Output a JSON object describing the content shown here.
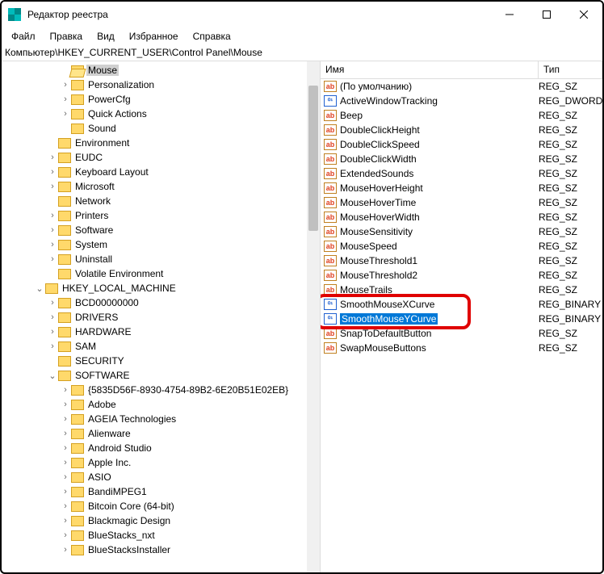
{
  "window": {
    "title": "Редактор реестра"
  },
  "menu": {
    "file": "Файл",
    "edit": "Правка",
    "view": "Вид",
    "favorites": "Избранное",
    "help": "Справка"
  },
  "path": "Компьютер\\HKEY_CURRENT_USER\\Control Panel\\Mouse",
  "columns": {
    "name": "Имя",
    "type": "Тип"
  },
  "tree": [
    {
      "ind": 72,
      "exp": "",
      "label": "Mouse",
      "selected": true,
      "open": true
    },
    {
      "ind": 72,
      "exp": ">",
      "label": "Personalization"
    },
    {
      "ind": 72,
      "exp": ">",
      "label": "PowerCfg"
    },
    {
      "ind": 72,
      "exp": ">",
      "label": "Quick Actions"
    },
    {
      "ind": 72,
      "exp": "",
      "label": "Sound"
    },
    {
      "ind": 56,
      "exp": "",
      "label": "Environment"
    },
    {
      "ind": 56,
      "exp": ">",
      "label": "EUDC"
    },
    {
      "ind": 56,
      "exp": ">",
      "label": "Keyboard Layout"
    },
    {
      "ind": 56,
      "exp": ">",
      "label": "Microsoft"
    },
    {
      "ind": 56,
      "exp": "",
      "label": "Network"
    },
    {
      "ind": 56,
      "exp": ">",
      "label": "Printers"
    },
    {
      "ind": 56,
      "exp": ">",
      "label": "Software"
    },
    {
      "ind": 56,
      "exp": ">",
      "label": "System"
    },
    {
      "ind": 56,
      "exp": ">",
      "label": "Uninstall"
    },
    {
      "ind": 56,
      "exp": "",
      "label": "Volatile Environment"
    },
    {
      "ind": 40,
      "exp": "v",
      "label": "HKEY_LOCAL_MACHINE",
      "nofolder": false
    },
    {
      "ind": 56,
      "exp": ">",
      "label": "BCD00000000"
    },
    {
      "ind": 56,
      "exp": ">",
      "label": "DRIVERS"
    },
    {
      "ind": 56,
      "exp": ">",
      "label": "HARDWARE"
    },
    {
      "ind": 56,
      "exp": ">",
      "label": "SAM"
    },
    {
      "ind": 56,
      "exp": "",
      "label": "SECURITY"
    },
    {
      "ind": 56,
      "exp": "v",
      "label": "SOFTWARE"
    },
    {
      "ind": 72,
      "exp": ">",
      "label": "{5835D56F-8930-4754-89B2-6E20B51E02EB}"
    },
    {
      "ind": 72,
      "exp": ">",
      "label": "Adobe"
    },
    {
      "ind": 72,
      "exp": ">",
      "label": "AGEIA Technologies"
    },
    {
      "ind": 72,
      "exp": ">",
      "label": "Alienware"
    },
    {
      "ind": 72,
      "exp": ">",
      "label": "Android Studio"
    },
    {
      "ind": 72,
      "exp": ">",
      "label": "Apple Inc."
    },
    {
      "ind": 72,
      "exp": ">",
      "label": "ASIO"
    },
    {
      "ind": 72,
      "exp": ">",
      "label": "BandiMPEG1"
    },
    {
      "ind": 72,
      "exp": ">",
      "label": "Bitcoin Core (64-bit)"
    },
    {
      "ind": 72,
      "exp": ">",
      "label": "Blackmagic Design"
    },
    {
      "ind": 72,
      "exp": ">",
      "label": "BlueStacks_nxt"
    },
    {
      "ind": 72,
      "exp": ">",
      "label": "BlueStacksInstaller"
    }
  ],
  "values": [
    {
      "name": "(По умолчанию)",
      "type": "REG_SZ",
      "kind": "sz"
    },
    {
      "name": "ActiveWindowTracking",
      "type": "REG_DWORD",
      "kind": "bin"
    },
    {
      "name": "Beep",
      "type": "REG_SZ",
      "kind": "sz"
    },
    {
      "name": "DoubleClickHeight",
      "type": "REG_SZ",
      "kind": "sz"
    },
    {
      "name": "DoubleClickSpeed",
      "type": "REG_SZ",
      "kind": "sz"
    },
    {
      "name": "DoubleClickWidth",
      "type": "REG_SZ",
      "kind": "sz"
    },
    {
      "name": "ExtendedSounds",
      "type": "REG_SZ",
      "kind": "sz"
    },
    {
      "name": "MouseHoverHeight",
      "type": "REG_SZ",
      "kind": "sz"
    },
    {
      "name": "MouseHoverTime",
      "type": "REG_SZ",
      "kind": "sz"
    },
    {
      "name": "MouseHoverWidth",
      "type": "REG_SZ",
      "kind": "sz"
    },
    {
      "name": "MouseSensitivity",
      "type": "REG_SZ",
      "kind": "sz"
    },
    {
      "name": "MouseSpeed",
      "type": "REG_SZ",
      "kind": "sz"
    },
    {
      "name": "MouseThreshold1",
      "type": "REG_SZ",
      "kind": "sz"
    },
    {
      "name": "MouseThreshold2",
      "type": "REG_SZ",
      "kind": "sz"
    },
    {
      "name": "MouseTrails",
      "type": "REG_SZ",
      "kind": "sz"
    },
    {
      "name": "SmoothMouseXCurve",
      "type": "REG_BINARY",
      "kind": "bin"
    },
    {
      "name": "SmoothMouseYCurve",
      "type": "REG_BINARY",
      "kind": "bin",
      "selected": true
    },
    {
      "name": "SnapToDefaultButton",
      "type": "REG_SZ",
      "kind": "sz"
    },
    {
      "name": "SwapMouseButtons",
      "type": "REG_SZ",
      "kind": "sz"
    }
  ],
  "highlight_index": 16
}
